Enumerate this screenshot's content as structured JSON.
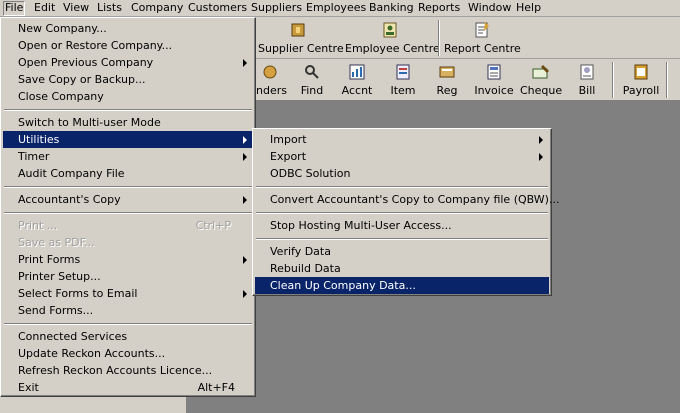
{
  "menubar": [
    "File",
    "Edit",
    "View",
    "Lists",
    "Company",
    "Customers",
    "Suppliers",
    "Employees",
    "Banking",
    "Reports",
    "Window",
    "Help"
  ],
  "toolbar1": {
    "supplier_centre": "Supplier Centre",
    "employee_centre": "Employee Centre",
    "report_centre": "Report Centre"
  },
  "toolbar2": [
    "inders",
    "Find",
    "Accnt",
    "Item",
    "Reg",
    "Invoice",
    "Cheque",
    "Bill",
    "Payroll"
  ],
  "file_menu": {
    "new_company": "New Company...",
    "open_restore": "Open or Restore Company...",
    "open_previous": "Open Previous Company",
    "save_copy": "Save Copy or Backup...",
    "close_company": "Close Company",
    "switch_multi": "Switch to Multi-user Mode",
    "utilities": "Utilities",
    "timer": "Timer",
    "audit": "Audit Company File",
    "accountants_copy": "Accountant's Copy",
    "print": "Print ...",
    "print_shortcut": "Ctrl+P",
    "save_pdf": "Save as PDF...",
    "print_forms": "Print Forms",
    "printer_setup": "Printer Setup...",
    "select_email": "Select Forms to Email",
    "send_forms": "Send Forms...",
    "connected": "Connected Services",
    "update_reckon": "Update Reckon Accounts...",
    "refresh_licence": "Refresh Reckon Accounts Licence...",
    "exit": "Exit",
    "exit_shortcut": "Alt+F4"
  },
  "utilities_menu": {
    "import": "Import",
    "export": "Export",
    "odbc": "ODBC Solution",
    "convert": "Convert Accountant's Copy to Company file (QBW)...",
    "stop_hosting": "Stop Hosting Multi-User Access...",
    "verify": "Verify Data",
    "rebuild": "Rebuild Data",
    "cleanup": "Clean Up Company Data..."
  },
  "colors": {
    "menu_bg": "#d4d0c8",
    "highlight": "#0a246a",
    "workspace": "#808080"
  }
}
